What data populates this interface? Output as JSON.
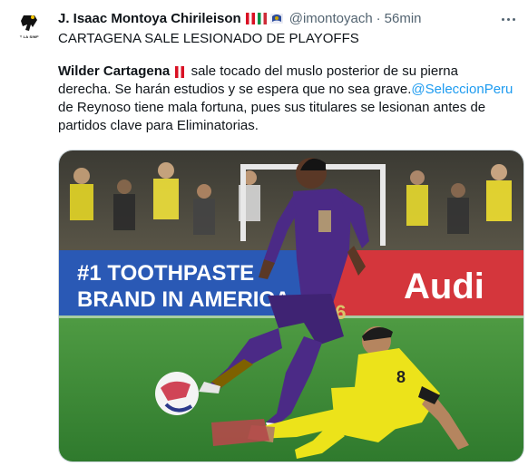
{
  "author": {
    "name": "J. Isaac Montoya Chirileison",
    "handle": "@imontoyach",
    "separator": "·",
    "time": "56min",
    "avatar_text": "HAZ LA SIMPLE",
    "flags": [
      "peru-flag",
      "italy-flag",
      "emblem-flag"
    ]
  },
  "tweet": {
    "headline": "CARTAGENA SALE LESIONADO DE PLAYOFFS",
    "mention_name": "Wilder Cartagena",
    "line1_rest": "sale tocado del muslo posterior de su pierna",
    "line2_text": "derecha. Se harán estudios y se espera que no sea grave.",
    "line2_link": "@SeleccionPeru",
    "line3": "de Reynoso tiene mala fortuna, pues sus titulares se lesionan antes de",
    "line4": "partidos clave para Eliminatorias."
  },
  "image": {
    "board_left": "#1 TOOTHPASTE",
    "board_left_2": "BRAND IN AMERICA",
    "board_right": "Audi",
    "player_number": "16",
    "opponent_number": "8"
  },
  "colors": {
    "link": "#1d9bf0",
    "orlando_purple": "#4b2a86",
    "nashville_yellow": "#ece31a",
    "pitch_green": "#3f8f3a"
  }
}
